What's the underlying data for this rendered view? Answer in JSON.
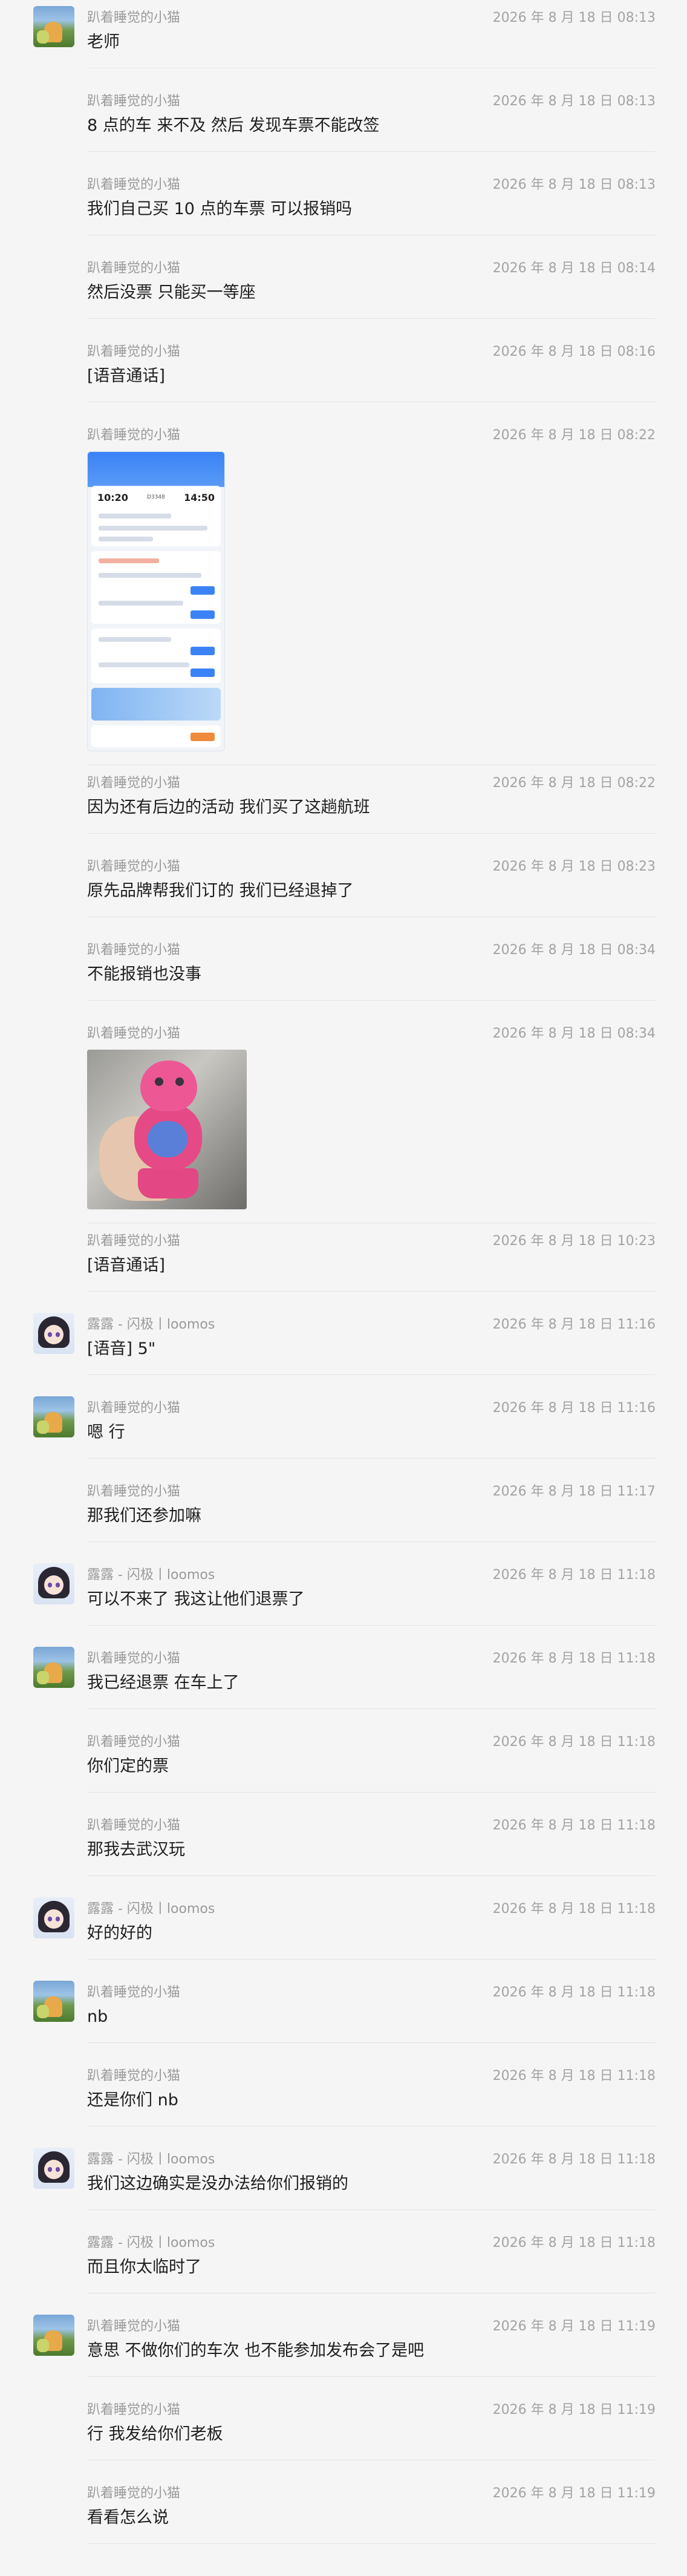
{
  "messages": [
    {
      "sender": "趴着睡觉的小猫",
      "time": "2026 年 8 月 18 日 08:13",
      "text": "老师",
      "avatar": "cat"
    },
    {
      "sender": "趴着睡觉的小猫",
      "time": "2026 年 8 月 18 日 08:13",
      "text": "8 点的车 来不及 然后 发现车票不能改签",
      "avatar": ""
    },
    {
      "sender": "趴着睡觉的小猫",
      "time": "2026 年 8 月 18 日 08:13",
      "text": "我们自己买 10 点的车票 可以报销吗",
      "avatar": ""
    },
    {
      "sender": "趴着睡觉的小猫",
      "time": "2026 年 8 月 18 日 08:14",
      "text": "然后没票 只能买一等座",
      "avatar": ""
    },
    {
      "sender": "趴着睡觉的小猫",
      "time": "2026 年 8 月 18 日 08:16",
      "text": "[语音通话]",
      "avatar": ""
    },
    {
      "sender": "趴着睡觉的小猫",
      "time": "2026 年 8 月 18 日 08:22",
      "text": "",
      "avatar": "",
      "image": "ticket-screenshot"
    },
    {
      "sender": "趴着睡觉的小猫",
      "time": "2026 年 8 月 18 日 08:22",
      "text": "因为还有后边的活动 我们买了这趟航班",
      "avatar": ""
    },
    {
      "sender": "趴着睡觉的小猫",
      "time": "2026 年 8 月 18 日 08:23",
      "text": "原先品牌帮我们订的 我们已经退掉了",
      "avatar": ""
    },
    {
      "sender": "趴着睡觉的小猫",
      "time": "2026 年 8 月 18 日 08:34",
      "text": "不能报销也没事",
      "avatar": ""
    },
    {
      "sender": "趴着睡觉的小猫",
      "time": "2026 年 8 月 18 日 08:34",
      "text": "",
      "avatar": "",
      "image": "toy-photo"
    },
    {
      "sender": "趴着睡觉的小猫",
      "time": "2026 年 8 月 18 日 10:23",
      "text": "[语音通话]",
      "avatar": ""
    },
    {
      "sender": "露露 - 闪极丨loomos",
      "time": "2026 年 8 月 18 日 11:16",
      "text": "[语音] 5\"",
      "avatar": "girl"
    },
    {
      "sender": "趴着睡觉的小猫",
      "time": "2026 年 8 月 18 日 11:16",
      "text": "嗯 行",
      "avatar": "cat"
    },
    {
      "sender": "趴着睡觉的小猫",
      "time": "2026 年 8 月 18 日 11:17",
      "text": "那我们还参加嘛",
      "avatar": ""
    },
    {
      "sender": "露露 - 闪极丨loomos",
      "time": "2026 年 8 月 18 日 11:18",
      "text": "可以不来了 我这让他们退票了",
      "avatar": "girl"
    },
    {
      "sender": "趴着睡觉的小猫",
      "time": "2026 年 8 月 18 日 11:18",
      "text": "我已经退票 在车上了",
      "avatar": "cat"
    },
    {
      "sender": "趴着睡觉的小猫",
      "time": "2026 年 8 月 18 日 11:18",
      "text": "你们定的票",
      "avatar": ""
    },
    {
      "sender": "趴着睡觉的小猫",
      "time": "2026 年 8 月 18 日 11:18",
      "text": "那我去武汉玩",
      "avatar": ""
    },
    {
      "sender": "露露 - 闪极丨loomos",
      "time": "2026 年 8 月 18 日 11:18",
      "text": "好的好的",
      "avatar": "girl"
    },
    {
      "sender": "趴着睡觉的小猫",
      "time": "2026 年 8 月 18 日 11:18",
      "text": "nb",
      "avatar": "cat"
    },
    {
      "sender": "趴着睡觉的小猫",
      "time": "2026 年 8 月 18 日 11:18",
      "text": "还是你们 nb",
      "avatar": ""
    },
    {
      "sender": "露露 - 闪极丨loomos",
      "time": "2026 年 8 月 18 日 11:18",
      "text": "我们这边确实是没办法给你们报销的",
      "avatar": "girl"
    },
    {
      "sender": "露露 - 闪极丨loomos",
      "time": "2026 年 8 月 18 日 11:18",
      "text": "而且你太临时了",
      "avatar": ""
    },
    {
      "sender": "趴着睡觉的小猫",
      "time": "2026 年 8 月 18 日 11:19",
      "text": "意思 不做你们的车次 也不能参加发布会了是吧",
      "avatar": "cat"
    },
    {
      "sender": "趴着睡觉的小猫",
      "time": "2026 年 8 月 18 日 11:19",
      "text": "行 我发给你们老板",
      "avatar": ""
    },
    {
      "sender": "趴着睡觉的小猫",
      "time": "2026 年 8 月 18 日 11:19",
      "text": "看看怎么说",
      "avatar": ""
    }
  ],
  "ticket": {
    "dep_time": "10:20",
    "arr_time": "14:50",
    "train": "D3348"
  }
}
